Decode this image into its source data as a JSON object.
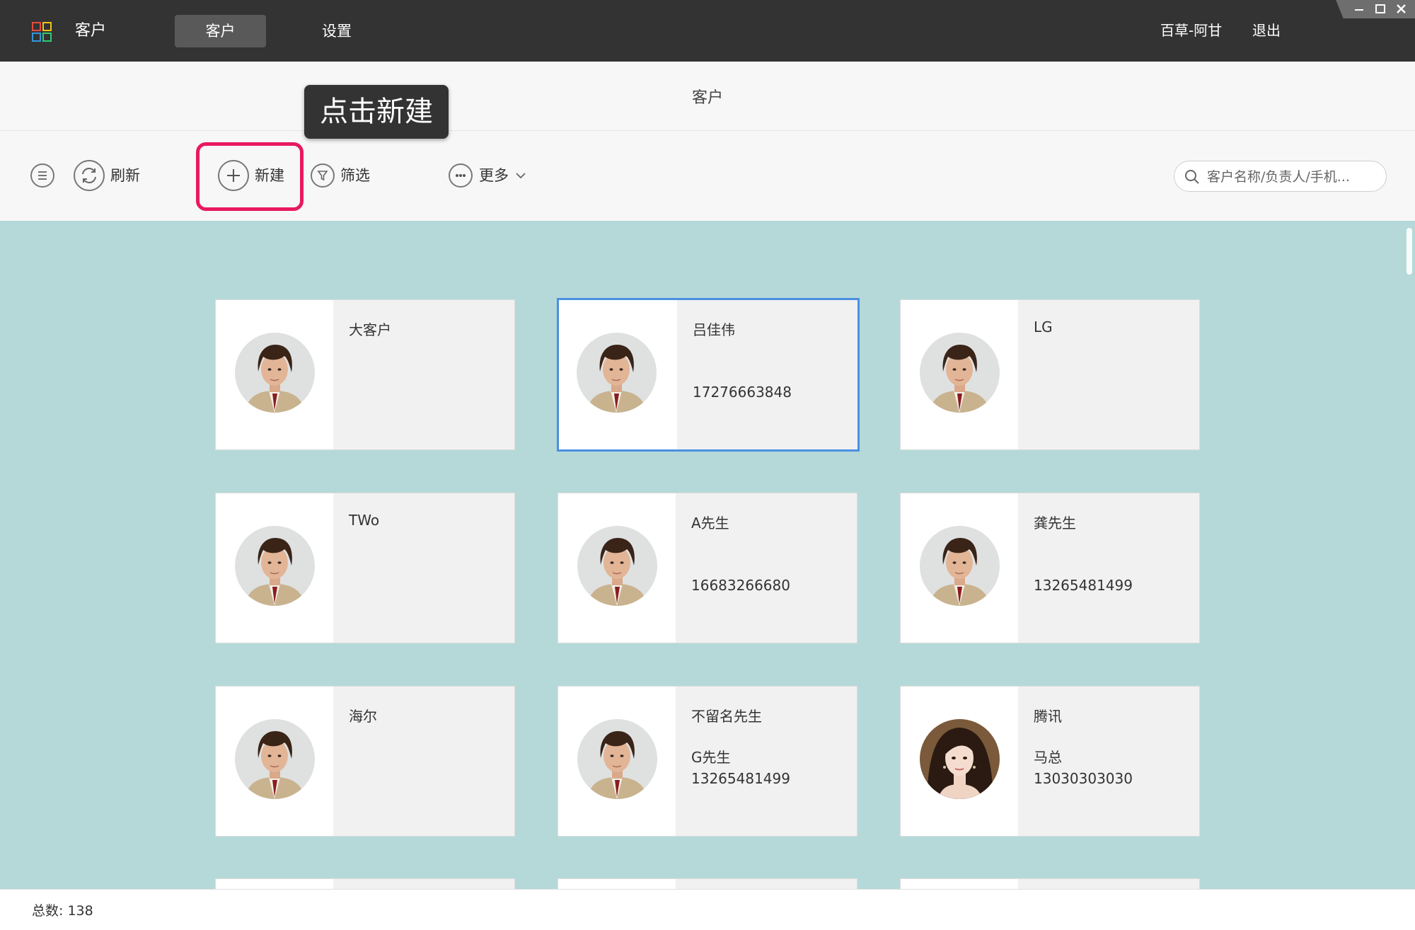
{
  "app": {
    "name": "客户"
  },
  "nav": {
    "tabs": [
      {
        "label": "客户"
      },
      {
        "label": "设置"
      }
    ]
  },
  "user": {
    "name": "百草-阿甘",
    "logout": "退出"
  },
  "header": {
    "title": "客户"
  },
  "tooltip": {
    "text": "点击新建"
  },
  "toolbar": {
    "refresh_label": "刷新",
    "new_label": "新建",
    "filter_label": "筛选",
    "more_label": "更多"
  },
  "search": {
    "placeholder": "客户名称/负责人/手机..."
  },
  "cards": [
    {
      "name": "大客户",
      "contact": "",
      "phone": ""
    },
    {
      "name": "吕佳伟",
      "contact": "",
      "phone": "17276663848"
    },
    {
      "name": "LG",
      "contact": "",
      "phone": ""
    },
    {
      "name": "TWo",
      "contact": "",
      "phone": ""
    },
    {
      "name": "A先生",
      "contact": "",
      "phone": "16683266680"
    },
    {
      "name": "龚先生",
      "contact": "",
      "phone": "13265481499"
    },
    {
      "name": "海尔",
      "contact": "",
      "phone": ""
    },
    {
      "name": "不留名先生",
      "contact": "G先生",
      "phone": "13265481499"
    },
    {
      "name": "腾讯",
      "contact": "马总",
      "phone": "13030303030"
    }
  ],
  "footer": {
    "total_label": "总数:",
    "total_value": "138"
  },
  "colors": {
    "accent_highlight": "#e8195f",
    "selected_border": "#4a90e2",
    "content_bg": "#b5d9d9"
  }
}
